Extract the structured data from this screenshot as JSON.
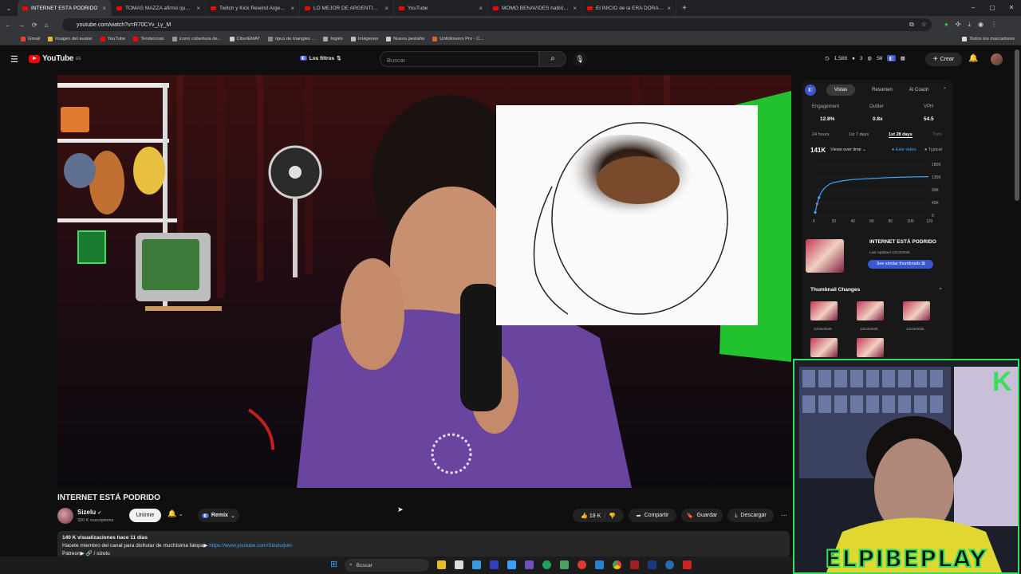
{
  "browser": {
    "tabs": [
      {
        "label": "INTERNET ESTÁ PODRIDO",
        "active": true
      },
      {
        "label": "TOMAS MAZZA afirmó que PE",
        "active": false
      },
      {
        "label": "Twitch y Kick Rewind Argentina",
        "active": false
      },
      {
        "label": "LO MEJOR DE ARGENTINA 202",
        "active": false
      },
      {
        "label": "YouTube",
        "active": false
      },
      {
        "label": "MOMO BENAVIDES habló de s",
        "active": false
      },
      {
        "label": "El INICIO de la ERA DORADA",
        "active": false
      }
    ],
    "url": "youtube.com/watch?v=R70CYv_Ly_M",
    "bookmarks": [
      "Gmail",
      "Imagen del avatar",
      "YouTube",
      "Tendencias",
      "icono cobertura de...",
      "CiberEMAT",
      "tipus de triangles ...",
      "Inglés",
      "Imágenes",
      "Nueva pestaña",
      "Unfollowers Pro - C...",
      "Todos los marcadores"
    ]
  },
  "header": {
    "logo_text": "YouTube",
    "logo_region": "ES",
    "filters_label": "Los filtros",
    "search_placeholder": "Buscar",
    "stats": {
      "a": "1,588",
      "b": "3",
      "c": "58"
    },
    "create_label": "Crear"
  },
  "video": {
    "title": "INTERNET ESTÁ PODRIDO",
    "channel": "Sizelu",
    "subscribers": "320 K suscriptores",
    "join_label": "Unirme",
    "remix_label": "Remix",
    "likes": "18 K",
    "share_label": "Compartir",
    "save_label": "Guardar",
    "download_label": "Descargar",
    "desc_line1": "140 K visualizaciones  hace 11 días",
    "desc_line2": "Hacete miembro del canal para disfrutar de muchísima falopa▶",
    "desc_link": "https://www.youtube.com/Sizelu/join",
    "desc_line3": "Patreon▶ 🔗 / sizelu"
  },
  "panel": {
    "tabs": [
      "Vistas",
      "Resumen",
      "AI Coach"
    ],
    "metrics": [
      {
        "label": "Engagement",
        "value": "12.8%"
      },
      {
        "label": "Outlier",
        "value": "0.8x"
      },
      {
        "label": "VPH",
        "value": "54.5"
      }
    ],
    "ranges": [
      "24 hours",
      "1st 7 days",
      "1st 28 days",
      "Todo"
    ],
    "views_total": "141K",
    "views_mode": "Views over time",
    "legend_this": "Este video",
    "legend_typical": "Typical",
    "thumb_title": "INTERNET ESTÁ PODRIDO",
    "thumb_updated": "Last Updated 12/23/2025",
    "similar_label": "See similar thumbnails",
    "changes_title": "Thumbnail Changes",
    "change_dates": [
      "12/25/2025",
      "12/23/2025",
      "12/23/2025"
    ]
  },
  "chart_data": {
    "type": "line",
    "title": "",
    "x": [
      0,
      2,
      4,
      6,
      8,
      10,
      12,
      14,
      16,
      20,
      30,
      40,
      60,
      80,
      100,
      120
    ],
    "series": [
      {
        "name": "Este video",
        "values": [
          10,
          40,
          62,
          78,
          88,
          96,
          102,
          107,
          111,
          116,
          122,
          126,
          130,
          133,
          135,
          136
        ]
      }
    ],
    "x_ticks": [
      "0",
      "20",
      "40",
      "60",
      "80",
      "100",
      "120"
    ],
    "y_ticks": [
      "180K",
      "135K",
      "90K",
      "45K",
      "0"
    ],
    "xlim": [
      0,
      120
    ],
    "ylim": [
      0,
      180
    ],
    "accent": "#3ea6ff"
  },
  "webcam": {
    "overlay_text": "ELPIBEPLAY"
  },
  "taskbar": {
    "search_label": "Buscar"
  }
}
